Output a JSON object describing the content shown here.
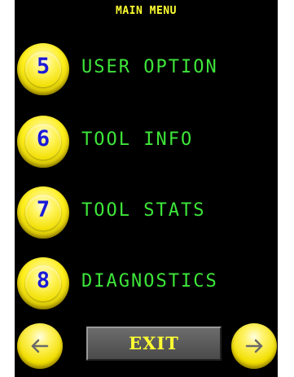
{
  "header": {
    "title": "MAIN MENU"
  },
  "menu": {
    "items": [
      {
        "number": "5",
        "label": "USER OPTION"
      },
      {
        "number": "6",
        "label": "TOOL INFO"
      },
      {
        "number": "7",
        "label": "TOOL STATS"
      },
      {
        "number": "8",
        "label": "DIAGNOSTICS"
      }
    ]
  },
  "footer": {
    "exit_label": "EXIT",
    "prev_icon": "left-arrow",
    "next_icon": "right-arrow"
  },
  "colors": {
    "background": "#000000",
    "title": "#ffff33",
    "label": "#3ee63a",
    "badge": "#ffef1a",
    "badge_number": "#1a1ad8",
    "exit_button": "#5a5a5a"
  }
}
